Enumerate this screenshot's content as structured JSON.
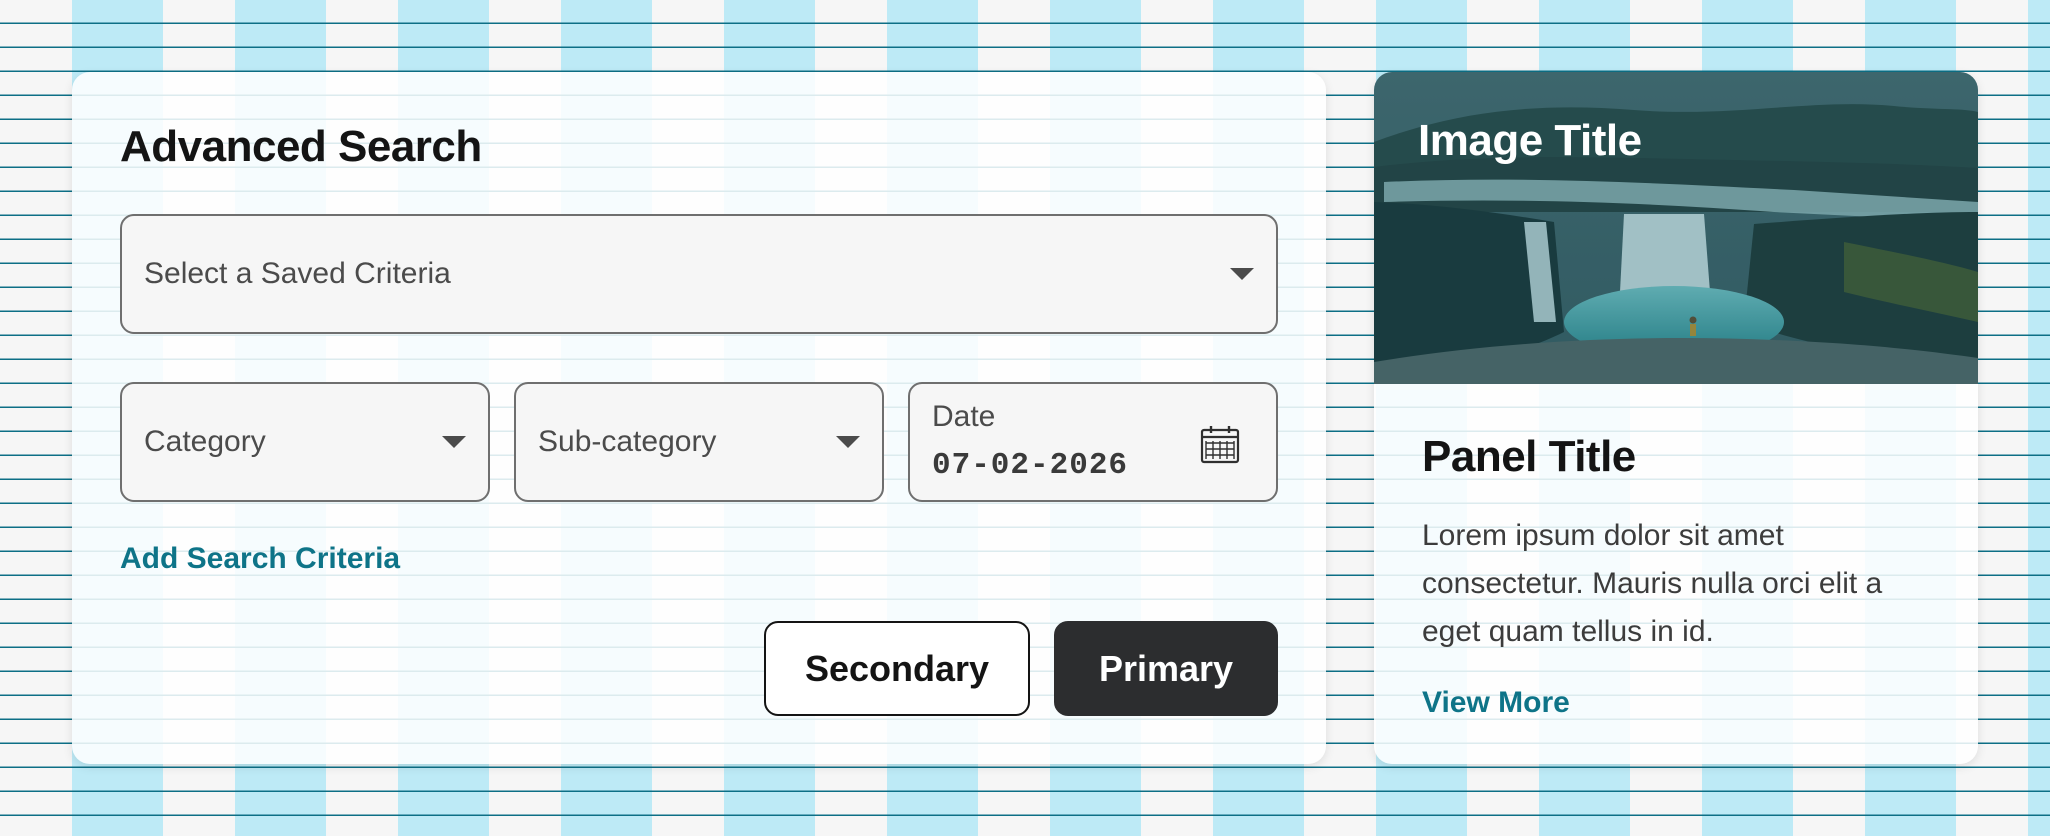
{
  "search": {
    "title": "Advanced Search",
    "saved_criteria_placeholder": "Select a Saved Criteria",
    "category_placeholder": "Category",
    "subcategory_placeholder": "Sub-category",
    "date_label": "Date",
    "date_value": "07-02-2026",
    "add_criteria_link": "Add Search Criteria",
    "secondary_button": "Secondary",
    "primary_button": "Primary"
  },
  "panel": {
    "image_title": "Image Title",
    "title": "Panel Title",
    "body": "Lorem ipsum dolor sit amet consectetur. Mauris nulla orci elit a eget quam tellus in id.",
    "view_more_link": "View More"
  },
  "colors": {
    "accent_link": "#0e7488",
    "primary_button_bg": "#2c2d2f",
    "background_stripe": "#bdeaf6",
    "background_rule": "#0d6f86"
  },
  "icons": {
    "dropdown": "chevron-down-icon",
    "date": "calendar-icon"
  }
}
